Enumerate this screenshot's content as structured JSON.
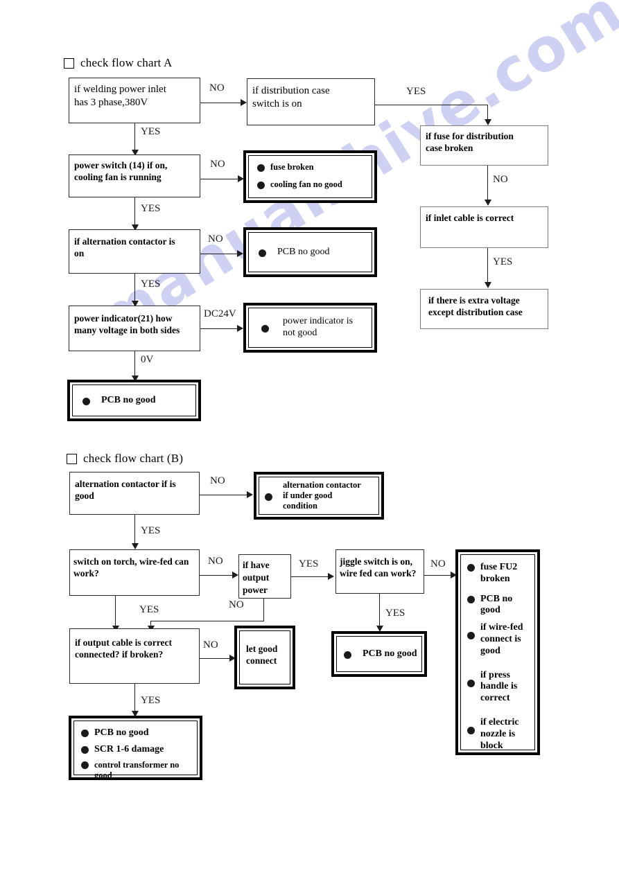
{
  "watermark": {
    "text": "manualshive.com"
  },
  "chart_a": {
    "header": {
      "title": "check flow chart A",
      "checkbox": "empty-checkbox-icon"
    },
    "nodes": {
      "n1": "if welding power inlet has 3 phase,380V",
      "n1_l1": "if welding power inlet",
      "n1_l2": "has 3 phase,380V",
      "n2_l1": "if distribution case",
      "n2_l2": "switch is on",
      "n3_l1": "if fuse for distribution",
      "n3_l2": "case broken",
      "n4": "if inlet cable is correct",
      "n5_l1": "if there is extra voltage",
      "n5_l2": "except distribution case",
      "n6_l1": "power switch (14) if on,",
      "n6_l2": "cooling fan is running",
      "n7_b1": "fuse broken",
      "n7_b2": "cooling fan no good",
      "n8_l1": "if alternation contactor is",
      "n8_l2": "on",
      "n9_b1": "PCB no good",
      "n10_l1": "power indicator(21)  how",
      "n10_l2": "many voltage in both sides",
      "n11_b1_l1": "power indicator is",
      "n11_b1_l2": "not good",
      "n12_b1": "PCB no good"
    },
    "edges": {
      "e_no_1": "NO",
      "e_yes_1": "YES",
      "e_yes_2": "YES",
      "e_no_2": "NO",
      "e_yes_3": "YES",
      "e_no_3": "NO",
      "e_yes_4": "YES",
      "e_no_4": "NO",
      "e_yes_5": "YES",
      "e_dc24v": "DC24V",
      "e_0v": "0V"
    }
  },
  "chart_b": {
    "header": {
      "title": "check flow chart (B)",
      "checkbox": "empty-checkbox-icon"
    },
    "nodes": {
      "m1_l1": "alternation contactor if is",
      "m1_l2": "good",
      "m2_b1_l1": "alternation contactor",
      "m2_b1_l2": "if under good",
      "m2_b1_l3": "condition",
      "m3_l1": "switch on torch, wire-fed can",
      "m3_l2": "work?",
      "m4_l1": "if have",
      "m4_l2": "output",
      "m4_l3": "power",
      "m5_l1": "jiggle switch is on,",
      "m5_l2": "wire fed can work?",
      "m6_items": [
        "fuse FU2 broken",
        "PCB no good",
        "if wire-fed connect is good",
        "if press handle is correct",
        "if electric nozzle is block"
      ],
      "m6_i1_l1": "fuse FU2",
      "m6_i1_l2": "broken",
      "m6_i2_l1": "PCB no",
      "m6_i2_l2": "good",
      "m6_i3_l1": "if wire-fed",
      "m6_i3_l2": "connect is",
      "m6_i3_l3": "good",
      "m6_i4_l1": "if press",
      "m6_i4_l2": "handle is",
      "m6_i4_l3": "correct",
      "m6_i5_l1": "if electric",
      "m6_i5_l2": "nozzle is",
      "m6_i5_l3": "block",
      "m7_b1": "PCB no good",
      "m8_l1": "if output cable is correct",
      "m8_l2": "connected? if broken?",
      "m9_l1": "let good",
      "m9_l2": "connect",
      "m10_b1": "PCB no good",
      "m10_b2": "SCR 1-6 damage",
      "m10_b3_l1": "control transformer no",
      "m10_b3_l2": "good"
    },
    "edges": {
      "e_no_1": "NO",
      "e_yes_1": "YES",
      "e_no_2": "NO",
      "e_yes_2": "YES",
      "e_no_3": "NO",
      "e_no_4": "NO",
      "e_yes_3": "YES",
      "e_yes_4": "YES",
      "e_no_5": "NO",
      "e_yes_5": "YES"
    }
  }
}
